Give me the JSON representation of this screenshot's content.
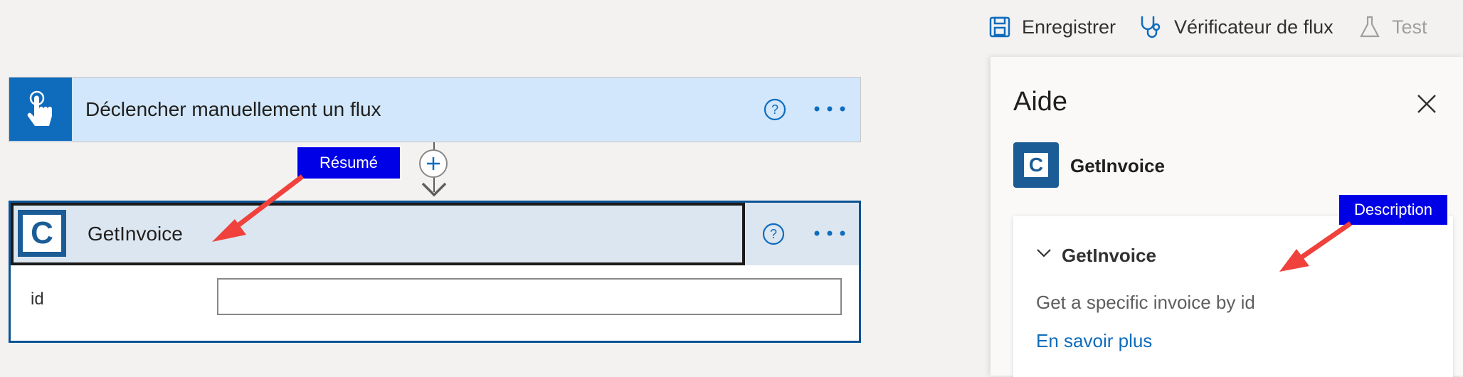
{
  "toolbar": {
    "save_label": "Enregistrer",
    "checker_label": "Vérificateur de flux",
    "test_label": "Test"
  },
  "trigger": {
    "title": "Déclencher manuellement un flux",
    "icon": "hand-touch-icon"
  },
  "action": {
    "title": "GetInvoice",
    "connector_logo_letter": "C",
    "fields": [
      {
        "label": "id",
        "value": ""
      }
    ]
  },
  "callouts": {
    "summary": "Résumé",
    "description": "Description"
  },
  "help_panel": {
    "title": "Aide",
    "connector_name": "GetInvoice",
    "connector_logo_letter": "C",
    "operation_name": "GetInvoice",
    "description": "Get a specific invoice by id",
    "learn_more": "En savoir plus"
  },
  "colors": {
    "accent": "#0f6cbd",
    "trigger_bg": "#d2e7fb",
    "action_header_bg": "#dce6f1",
    "callout_bg": "#0000e6",
    "arrow": "#f0413c"
  }
}
